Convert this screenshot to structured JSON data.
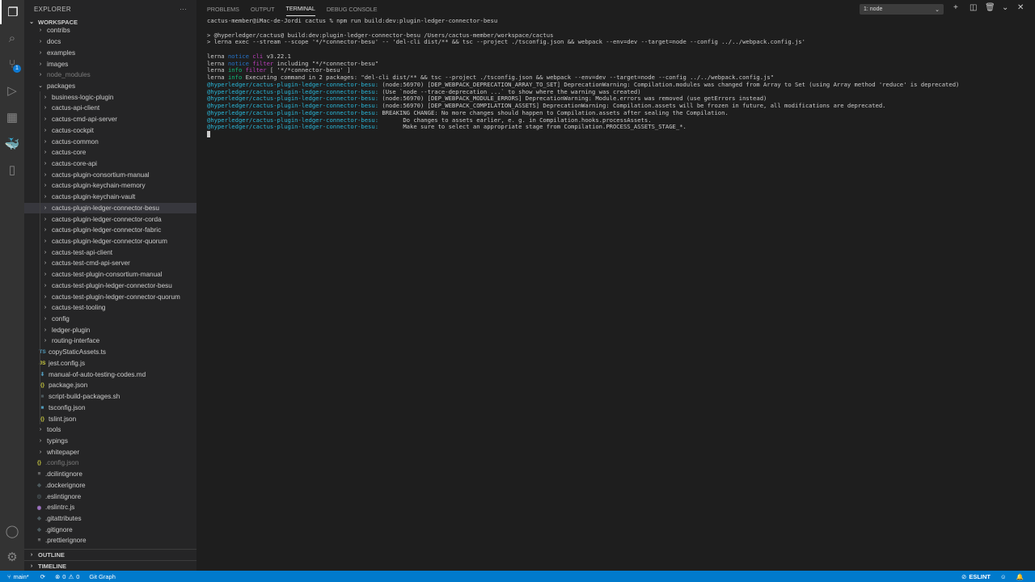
{
  "activity_bar": {
    "scm_badge": "1"
  },
  "sidebar": {
    "title": "EXPLORER",
    "more": "···",
    "workspace": "WORKSPACE",
    "tree": [
      {
        "label": "contribs",
        "kind": "folder",
        "level": 1
      },
      {
        "label": "docs",
        "kind": "folder",
        "level": 1
      },
      {
        "label": "examples",
        "kind": "folder",
        "level": 1
      },
      {
        "label": "images",
        "kind": "folder",
        "level": 1
      },
      {
        "label": "node_modules",
        "kind": "folder",
        "level": 1,
        "dim": true
      },
      {
        "label": "packages",
        "kind": "folder-open",
        "level": 1
      },
      {
        "label": "business-logic-plugin",
        "kind": "folder",
        "level": 2
      },
      {
        "label": "cactus-api-client",
        "kind": "folder",
        "level": 2
      },
      {
        "label": "cactus-cmd-api-server",
        "kind": "folder",
        "level": 2
      },
      {
        "label": "cactus-cockpit",
        "kind": "folder",
        "level": 2
      },
      {
        "label": "cactus-common",
        "kind": "folder",
        "level": 2
      },
      {
        "label": "cactus-core",
        "kind": "folder",
        "level": 2
      },
      {
        "label": "cactus-core-api",
        "kind": "folder",
        "level": 2
      },
      {
        "label": "cactus-plugin-consortium-manual",
        "kind": "folder",
        "level": 2
      },
      {
        "label": "cactus-plugin-keychain-memory",
        "kind": "folder",
        "level": 2
      },
      {
        "label": "cactus-plugin-keychain-vault",
        "kind": "folder",
        "level": 2
      },
      {
        "label": "cactus-plugin-ledger-connector-besu",
        "kind": "folder",
        "level": 2,
        "selected": true
      },
      {
        "label": "cactus-plugin-ledger-connector-corda",
        "kind": "folder",
        "level": 2
      },
      {
        "label": "cactus-plugin-ledger-connector-fabric",
        "kind": "folder",
        "level": 2
      },
      {
        "label": "cactus-plugin-ledger-connector-quorum",
        "kind": "folder",
        "level": 2
      },
      {
        "label": "cactus-test-api-client",
        "kind": "folder",
        "level": 2
      },
      {
        "label": "cactus-test-cmd-api-server",
        "kind": "folder",
        "level": 2
      },
      {
        "label": "cactus-test-plugin-consortium-manual",
        "kind": "folder",
        "level": 2
      },
      {
        "label": "cactus-test-plugin-ledger-connector-besu",
        "kind": "folder",
        "level": 2
      },
      {
        "label": "cactus-test-plugin-ledger-connector-quorum",
        "kind": "folder",
        "level": 2
      },
      {
        "label": "cactus-test-tooling",
        "kind": "folder",
        "level": 2
      },
      {
        "label": "config",
        "kind": "folder",
        "level": 2
      },
      {
        "label": "ledger-plugin",
        "kind": "folder",
        "level": 2
      },
      {
        "label": "routing-interface",
        "kind": "folder",
        "level": 2
      },
      {
        "label": "copyStaticAssets.ts",
        "kind": "file",
        "level": 2,
        "icon": "TS",
        "color": "#519aba"
      },
      {
        "label": "jest.config.js",
        "kind": "file",
        "level": 2,
        "icon": "JS",
        "color": "#cbcb41"
      },
      {
        "label": "manual-of-auto-testing-codes.md",
        "kind": "file",
        "level": 2,
        "icon": "⬇",
        "color": "#519aba"
      },
      {
        "label": "package.json",
        "kind": "file",
        "level": 2,
        "icon": "{}",
        "color": "#cbcb41"
      },
      {
        "label": "script-build-packages.sh",
        "kind": "file",
        "level": 2,
        "icon": "■",
        "color": "#4d5a5e"
      },
      {
        "label": "tsconfig.json",
        "kind": "file",
        "level": 2,
        "icon": "■",
        "color": "#519aba"
      },
      {
        "label": "tslint.json",
        "kind": "file",
        "level": 2,
        "icon": "{}",
        "color": "#cbcb41"
      },
      {
        "label": "tools",
        "kind": "folder",
        "level": 1
      },
      {
        "label": "typings",
        "kind": "folder",
        "level": 1
      },
      {
        "label": "whitepaper",
        "kind": "folder",
        "level": 1
      },
      {
        "label": ".config.json",
        "kind": "file",
        "level": 1,
        "icon": "{}",
        "color": "#cbcb41",
        "dim": true
      },
      {
        "label": ".dcilintignore",
        "kind": "file",
        "level": 1,
        "icon": "≡",
        "color": "#aaaaaa"
      },
      {
        "label": ".dockerignore",
        "kind": "file",
        "level": 1,
        "icon": "◆",
        "color": "#4d5a5e"
      },
      {
        "label": ".eslintignore",
        "kind": "file",
        "level": 1,
        "icon": "◎",
        "color": "#4d5a5e"
      },
      {
        "label": ".eslintrc.js",
        "kind": "file",
        "level": 1,
        "icon": "◉",
        "color": "#a074c4"
      },
      {
        "label": ".gitattributes",
        "kind": "file",
        "level": 1,
        "icon": "◆",
        "color": "#4d5a5e"
      },
      {
        "label": ".gitignore",
        "kind": "file",
        "level": 1,
        "icon": "◆",
        "color": "#4d5a5e"
      },
      {
        "label": ".prettierignore",
        "kind": "file",
        "level": 1,
        "icon": "≡",
        "color": "#aaaaaa"
      }
    ],
    "outline": "OUTLINE",
    "timeline": "TIMELINE"
  },
  "panel": {
    "tabs": [
      "PROBLEMS",
      "OUTPUT",
      "TERMINAL",
      "DEBUG CONSOLE"
    ],
    "active_tab": "TERMINAL",
    "terminal_select": "1: node",
    "terminal_lines": [
      [
        {
          "t": "cactus-member@iMac-de-Jordi cactus % npm run build:dev:plugin-ledger-connector-besu"
        }
      ],
      [
        {
          "t": ""
        }
      ],
      [
        {
          "t": "> @hyperledger/cactus@ build:dev:plugin-ledger-connector-besu /Users/cactus-member/workspace/cactus"
        }
      ],
      [
        {
          "t": "> lerna exec --stream --scope '*/*connector-besu' -- 'del-cli dist/** && tsc --project ./tsconfig.json && webpack --env=dev --target=node --config ../../webpack.config.js'"
        }
      ],
      [
        {
          "t": ""
        }
      ],
      [
        {
          "t": "lerna "
        },
        {
          "t": "notice",
          "c": "c-blue"
        },
        {
          "t": " cli",
          "c": "c-mag"
        },
        {
          "t": " v3.22.1"
        }
      ],
      [
        {
          "t": "lerna "
        },
        {
          "t": "notice",
          "c": "c-blue"
        },
        {
          "t": " filter",
          "c": "c-mag"
        },
        {
          "t": " including \"*/*connector-besu\""
        }
      ],
      [
        {
          "t": "lerna "
        },
        {
          "t": "info",
          "c": "c-green"
        },
        {
          "t": " filter",
          "c": "c-mag"
        },
        {
          "t": " [ '*/*connector-besu' ]"
        }
      ],
      [
        {
          "t": "lerna "
        },
        {
          "t": "info",
          "c": "c-green"
        },
        {
          "t": " Executing command in 2 packages: \"del-cli dist/** && tsc --project ./tsconfig.json && webpack --env=dev --target=node --config ../../webpack.config.js\""
        }
      ],
      [
        {
          "t": "@hyperledger/cactus-plugin-ledger-connector-besu:",
          "c": "c-cyan"
        },
        {
          "t": " (node:56970) [DEP_WEBPACK_DEPRECATION_ARRAY_TO_SET] DeprecationWarning: Compilation.modules was changed from Array to Set (using Array method 'reduce' is deprecated)"
        }
      ],
      [
        {
          "t": "@hyperledger/cactus-plugin-ledger-connector-besu:",
          "c": "c-cyan"
        },
        {
          "t": " (Use `node --trace-deprecation ...` to show where the warning was created)"
        }
      ],
      [
        {
          "t": "@hyperledger/cactus-plugin-ledger-connector-besu:",
          "c": "c-cyan"
        },
        {
          "t": " (node:56970) [DEP_WEBPACK_MODULE_ERRORS] DeprecationWarning: Module.errors was removed (use getErrors instead)"
        }
      ],
      [
        {
          "t": "@hyperledger/cactus-plugin-ledger-connector-besu:",
          "c": "c-cyan"
        },
        {
          "t": " (node:56970) [DEP_WEBPACK_COMPILATION_ASSETS] DeprecationWarning: Compilation.assets will be frozen in future, all modifications are deprecated."
        }
      ],
      [
        {
          "t": "@hyperledger/cactus-plugin-ledger-connector-besu:",
          "c": "c-cyan"
        },
        {
          "t": " BREAKING CHANGE: No more changes should happen to Compilation.assets after sealing the Compilation."
        }
      ],
      [
        {
          "t": "@hyperledger/cactus-plugin-ledger-connector-besu:",
          "c": "c-cyan"
        },
        {
          "t": "       Do changes to assets earlier, e. g. in Compilation.hooks.processAssets."
        }
      ],
      [
        {
          "t": "@hyperledger/cactus-plugin-ledger-connector-besu:",
          "c": "c-cyan"
        },
        {
          "t": "       Make sure to select an appropriate stage from Compilation.PROCESS_ASSETS_STAGE_*."
        }
      ]
    ]
  },
  "status_bar": {
    "branch": "main*",
    "errors": "0",
    "warnings": "0",
    "git_graph": "Git Graph",
    "eslint": "ESLINT"
  },
  "colors": {
    "status_bar": "#007acc",
    "selection": "#37373d"
  }
}
